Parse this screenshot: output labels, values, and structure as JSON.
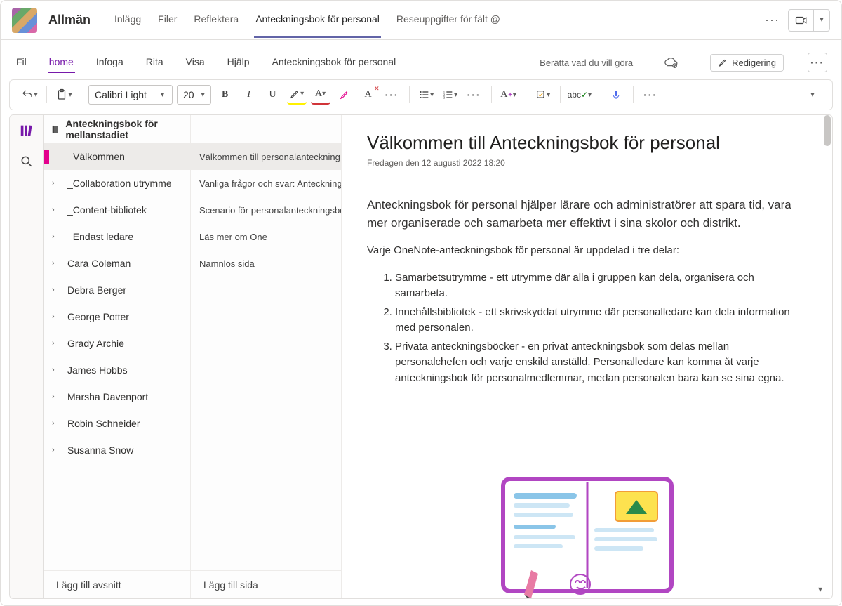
{
  "teams": {
    "channel_name": "Allmän",
    "tabs": [
      "Inlägg",
      "Filer",
      "Reflektera",
      "Anteckningsbok för personal",
      "Reseuppgifter för fält @"
    ],
    "active_tab_index": 3
  },
  "onenote_tabs": {
    "items": [
      "Fil",
      "home",
      "Infoga",
      "Rita",
      "Visa",
      "Hjälp",
      "Anteckningsbok för personal"
    ],
    "active_index": 1,
    "tell_me": "Berätta vad du vill göra",
    "edit_label": "Redigering"
  },
  "toolbar": {
    "font": "Calibri Light",
    "font_size": "20"
  },
  "notebook": {
    "title": "Anteckningsbok för mellanstadiet",
    "sections": [
      {
        "label": "Välkommen",
        "expandable": false,
        "active": true
      },
      {
        "label": "_Collaboration utrymme",
        "expandable": true
      },
      {
        "label": "_Content-bibliotek",
        "expandable": true
      },
      {
        "label": "_Endast ledare",
        "expandable": true
      },
      {
        "label": "Cara Coleman",
        "expandable": true
      },
      {
        "label": "Debra Berger",
        "expandable": true
      },
      {
        "label": "George Potter",
        "expandable": true
      },
      {
        "label": "Grady Archie",
        "expandable": true
      },
      {
        "label": "James Hobbs",
        "expandable": true
      },
      {
        "label": "Marsha Davenport",
        "expandable": true
      },
      {
        "label": "Robin Schneider",
        "expandable": true
      },
      {
        "label": "Susanna Snow",
        "expandable": true
      }
    ],
    "add_section": "Lägg till avsnitt",
    "pages": [
      {
        "label": "Välkommen till personalanteckning",
        "active": true
      },
      {
        "label": "Vanliga frågor och svar: Anteckningsbok för personal i ..."
      },
      {
        "label": "Scenario för personalanteckningsbok..."
      },
      {
        "label": "Läs mer om One"
      },
      {
        "label": "Namnlös sida"
      }
    ],
    "add_page": "Lägg till sida"
  },
  "page": {
    "title": "Välkommen till Anteckningsbok för personal",
    "date": "Fredagen den 12 augusti 2022 18:20",
    "intro": "Anteckningsbok för personal hjälper lärare och administratörer att spara tid, vara mer organiserade och samarbeta mer effektivt i sina skolor och distrikt.",
    "para2": "Varje OneNote-anteckningsbok för personal är uppdelad i tre delar:",
    "list": [
      "Samarbetsutrymme - ett utrymme där alla i gruppen kan dela, organisera och samarbeta.",
      "Innehållsbibliotek - ett skrivskyddat utrymme där personalledare kan dela information med personalen.",
      "Privata anteckningsböcker - en privat anteckningsbok som delas mellan personalchefen och varje enskild anställd. Personalledare kan komma åt varje anteckningsbok för personalmedlemmar, medan personalen bara kan se sina egna."
    ]
  }
}
